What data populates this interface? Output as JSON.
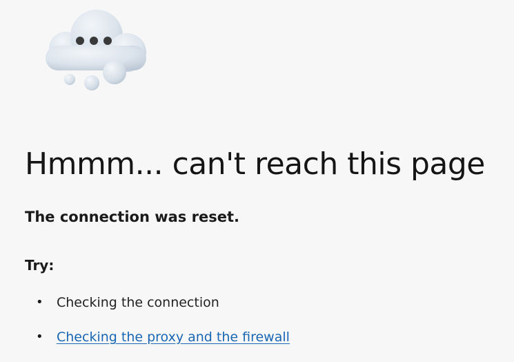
{
  "illustration": {
    "icon": "cloud-with-ellipsis-icon",
    "colors": {
      "cloud": "#dfe6ee",
      "cloud_shade": "#c6d1dc",
      "dots": "#3a3a3a"
    }
  },
  "error": {
    "headline": "Hmmm... can't reach this page",
    "message": "The connection was reset."
  },
  "suggestions": {
    "label": "Try:",
    "items": [
      {
        "text": "Checking the connection",
        "is_link": false
      },
      {
        "text": "Checking the proxy and the firewall",
        "is_link": true
      }
    ]
  },
  "colors": {
    "background": "#f7f7f7",
    "link": "#1866b4",
    "text": "#1a1a1a"
  }
}
